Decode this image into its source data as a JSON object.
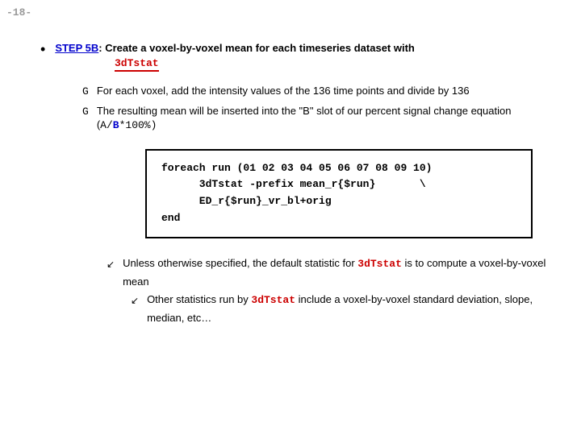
{
  "page_number": "-18-",
  "step": {
    "label": "STEP 5B",
    "text_after_label": ": Create a voxel-by-voxel mean for each timeseries dataset with",
    "program": "3dTstat"
  },
  "sub_points": {
    "p1": "For each voxel, add the intensity values of the 136 time points and divide by 136",
    "p2_a": "The resulting mean will be inserted into the \"B\" slot of our percent signal change equation (",
    "p2_A": "A",
    "p2_slash": "/",
    "p2_B": "B",
    "p2_rest": "*100%)"
  },
  "code": {
    "l1": "foreach run (01 02 03 04 05 06 07 08 09 10)",
    "l2": "      3dTstat -prefix mean_r{$run}       \\",
    "l3": "      ED_r{$run}_vr_bl+orig",
    "l4": "end"
  },
  "notes": {
    "n1_a": "Unless otherwise specified, the default statistic for ",
    "n1_prog": "3dTstat",
    "n1_b": " is to compute a voxel-by-voxel mean",
    "n2_a": "Other statistics run by ",
    "n2_prog": "3dTstat",
    "n2_b": " include a voxel-by-voxel standard deviation, slope, median, etc…"
  }
}
